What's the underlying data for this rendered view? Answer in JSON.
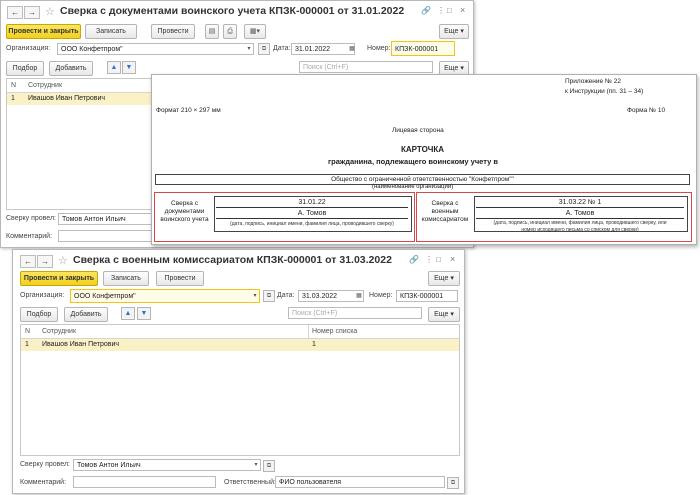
{
  "window1": {
    "title": "Сверка с документами воинского учета КПЗК-000001 от 31.01.2022",
    "toolbar": {
      "post_close": "Провести и закрыть",
      "save": "Записать",
      "post": "Провести",
      "more": "Еще"
    },
    "org_label": "Организация:",
    "org_value": "ООО Конфетпром\"",
    "date_label": "Дата:",
    "date_value": "31.01.2022",
    "number_label": "Номер:",
    "number_value": "КПЗК-000001",
    "select_btn": "Подбор",
    "add_btn": "Добавить",
    "search_placeholder": "Поиск (Ctrl+F)",
    "more": "Еще",
    "columns": [
      "N",
      "Сотрудник"
    ],
    "rows": [
      {
        "n": "1",
        "employee": "Ивашов Иван Петрович"
      }
    ],
    "checked_by_label": "Сверку провел:",
    "checked_by_value": "Томов Антон Ильич",
    "comment_label": "Комментарий:"
  },
  "print_form": {
    "appendix": "Приложение № 22",
    "instruction": "к Инструкции (пп. 31 – 34)",
    "format": "Формат 210 × 297 мм",
    "form_no": "Форма № 10",
    "side": "Лицевая сторона",
    "card_title": "КАРТОЧКА",
    "card_subtitle": "гражданина, подлежащего воинскому учету в",
    "org_name": "Общество с ограниченной ответственностью \"Конфетпром\"\"",
    "org_caption": "(наименование организации)",
    "left_label": "Сверка с документами воинского учета",
    "left_date": "31.01.22",
    "left_name": "А. Томов",
    "left_caption": "(дата, подпись, инициал имени, фамилия лица, проводившего сверку)",
    "right_label": "Сверка с военным комиссариатом",
    "right_date": "31.03.22 № 1",
    "right_name": "А. Томов",
    "right_caption1": "(дата, подпись, инициал имени, фамилия лица, проводившего сверку, или",
    "right_caption2": "номер исходящего письма со списком для сверки)"
  },
  "window2": {
    "title": "Сверка с военным комиссариатом КПЗК-000001 от 31.03.2022",
    "toolbar": {
      "post_close": "Провести и закрыть",
      "save": "Записать",
      "post": "Провести",
      "more": "Еще"
    },
    "org_label": "Организация:",
    "org_value": "ООО Конфетпром\"",
    "date_label": "Дата:",
    "date_value": "31.03.2022",
    "number_label": "Номер:",
    "number_value": "КПЗК-000001",
    "select_btn": "Подбор",
    "add_btn": "Добавить",
    "search_placeholder": "Поиск (Ctrl+F)",
    "more": "Еще",
    "columns": [
      "N",
      "Сотрудник",
      "Номер списка"
    ],
    "rows": [
      {
        "n": "1",
        "employee": "Ивашов Иван Петрович",
        "list_no": "1"
      }
    ],
    "checked_by_label": "Сверку провел:",
    "checked_by_value": "Томов Антон Ильич",
    "comment_label": "Комментарий:",
    "responsible_label": "Ответственный:",
    "responsible_value": "ФИО пользователя"
  },
  "icons": [
    "back-arrow-icon",
    "forward-arrow-icon",
    "star-icon",
    "link-icon",
    "more-vert-icon",
    "maximize-icon",
    "close-icon",
    "dropdown-icon",
    "open-icon",
    "calendar-icon",
    "arrow-up-icon",
    "arrow-down-icon",
    "clear-icon",
    "printer-icon",
    "document-icon"
  ],
  "colors": {
    "primary_button": "#f2cf1f",
    "selected_row": "#fbf1c6",
    "highlight_border": "#d24a4a"
  }
}
